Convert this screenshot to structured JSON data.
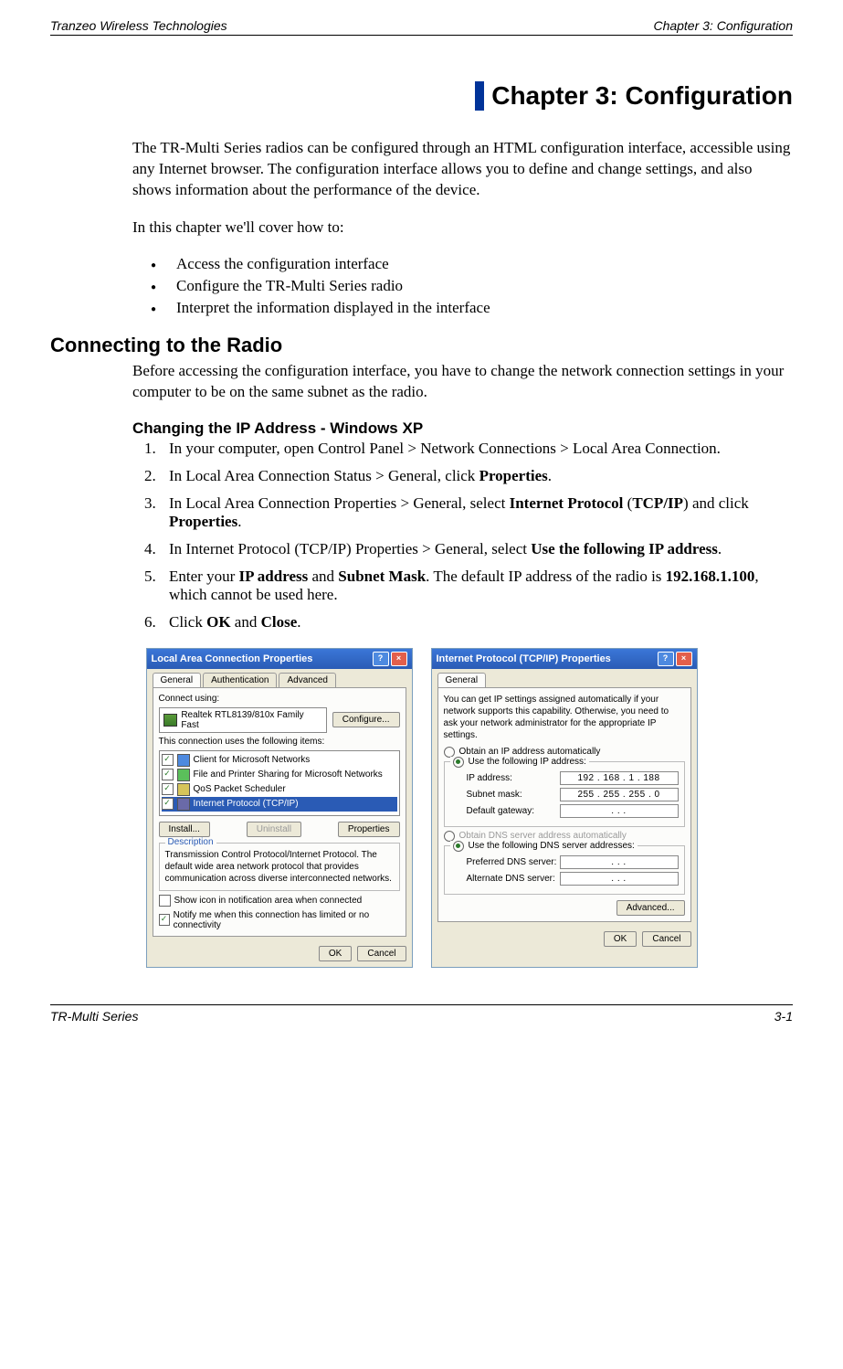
{
  "header": {
    "left": "Tranzeo Wireless Technologies",
    "right": "Chapter 3: Configuration"
  },
  "chapter_title": "Chapter 3: Configuration",
  "intro": "The TR-Multi Series radios can be configured through an HTML configuration interface, accessible using any Internet browser. The configuration interface allows you to define and change settings, and also shows information about the performance of the device.",
  "cover_line": "In this chapter we'll cover how to:",
  "bullets": [
    "Access the configuration interface",
    "Configure the TR-Multi Series radio",
    "Interpret the information displayed in the interface"
  ],
  "section1": {
    "title": "Connecting to the Radio",
    "text": "Before accessing the configuration interface, you have to change the network connection settings in your computer to be on the same subnet as the radio."
  },
  "sub1": {
    "title": "Changing the IP Address - Windows XP"
  },
  "steps": [
    {
      "pre": "In your computer, open Control Panel > Network Connections > Local Area Connection."
    },
    {
      "pre": "In Local Area Connection Status > General, click ",
      "b1": "Properties",
      "post": "."
    },
    {
      "pre": "In Local Area Connection Properties > General, select ",
      "b1": "Internet Protocol",
      "mid": " (",
      "b2": "TCP/IP",
      "mid2": ") and click ",
      "b3": "Properties",
      "post": "."
    },
    {
      "pre": "In Internet Protocol (TCP/IP) Properties > General, select ",
      "b1": "Use the following IP address",
      "post": "."
    },
    {
      "pre": "Enter your ",
      "b1": "IP address",
      "mid": " and ",
      "b2": "Subnet Mask",
      "mid2": ". The default IP address of the radio is ",
      "b3": "192.168.1.100",
      "post": ", which cannot be used here."
    },
    {
      "pre": "Click ",
      "b1": "OK",
      "mid": " and ",
      "b2": "Close",
      "post": "."
    }
  ],
  "dialog1": {
    "title": "Local Area Connection Properties",
    "help": "?",
    "close": "×",
    "tabs": [
      "General",
      "Authentication",
      "Advanced"
    ],
    "connect_using": "Connect using:",
    "nic": "Realtek RTL8139/810x Family Fast",
    "configure": "Configure...",
    "items_label": "This connection uses the following items:",
    "items": [
      "Client for Microsoft Networks",
      "File and Printer Sharing for Microsoft Networks",
      "QoS Packet Scheduler",
      "Internet Protocol (TCP/IP)"
    ],
    "install": "Install...",
    "uninstall": "Uninstall",
    "properties": "Properties",
    "desc_label": "Description",
    "desc_text": "Transmission Control Protocol/Internet Protocol. The default wide area network protocol that provides communication across diverse interconnected networks.",
    "show_icon": "Show icon in notification area when connected",
    "notify": "Notify me when this connection has limited or no connectivity",
    "ok": "OK",
    "cancel": "Cancel"
  },
  "dialog2": {
    "title": "Internet Protocol (TCP/IP) Properties",
    "help": "?",
    "close": "×",
    "tab": "General",
    "intro": "You can get IP settings assigned automatically if your network supports this capability. Otherwise, you need to ask your network administrator for the appropriate IP settings.",
    "r1": "Obtain an IP address automatically",
    "r2": "Use the following IP address:",
    "ip_label": "IP address:",
    "ip_value": "192 . 168 .  1  . 188",
    "mask_label": "Subnet mask:",
    "mask_value": "255 . 255 . 255 .  0",
    "gw_label": "Default gateway:",
    "gw_value": ".       .       .",
    "r3": "Obtain DNS server address automatically",
    "r4": "Use the following DNS server addresses:",
    "pdns_label": "Preferred DNS server:",
    "pdns_value": ".       .       .",
    "adns_label": "Alternate DNS server:",
    "adns_value": ".       .       .",
    "advanced": "Advanced...",
    "ok": "OK",
    "cancel": "Cancel"
  },
  "footer": {
    "left": "TR-Multi Series",
    "right": "3-1"
  }
}
